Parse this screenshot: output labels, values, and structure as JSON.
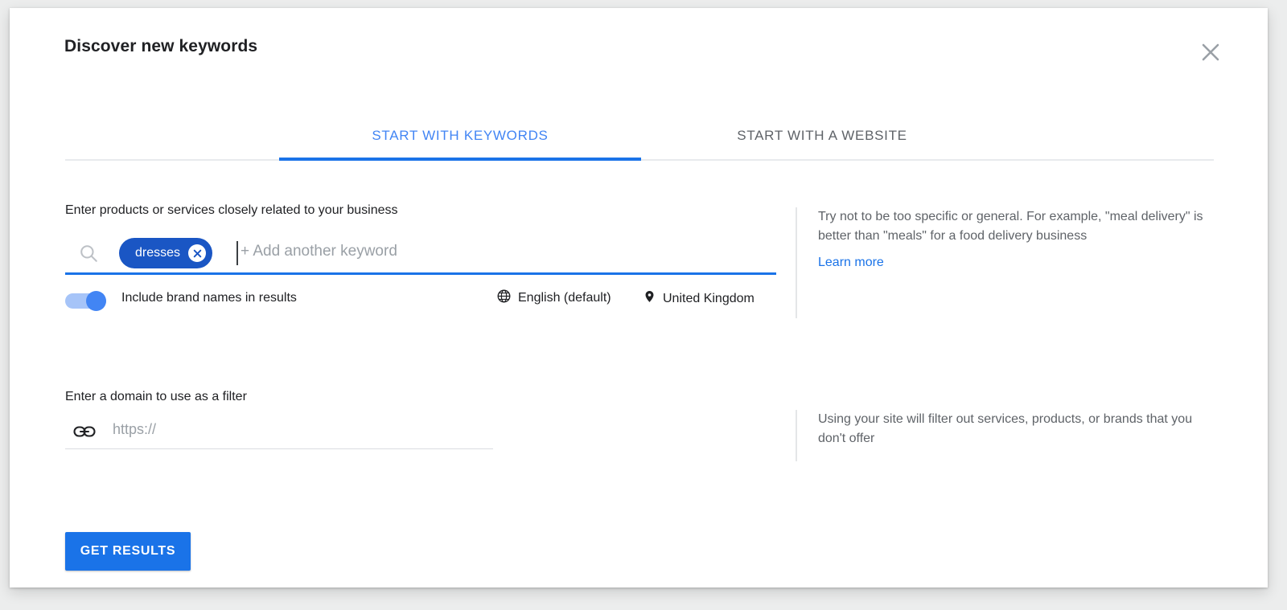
{
  "dialog": {
    "title": "Discover new keywords",
    "close_icon": "close-icon"
  },
  "tabs": [
    {
      "label": "START WITH KEYWORDS",
      "selected": true
    },
    {
      "label": "START WITH A WEBSITE",
      "selected": false
    }
  ],
  "keywords_section": {
    "label": "Enter products or services closely related to your business",
    "search_icon": "search-icon",
    "chips": [
      {
        "label": "dresses",
        "remove_icon": "close-circle-icon"
      }
    ],
    "input_placeholder": "+ Add another keyword",
    "input_value": "",
    "toggle": {
      "label": "Include brand names in results",
      "state": "on"
    },
    "language": {
      "icon": "globe-icon",
      "value": "English (default)"
    },
    "location": {
      "icon": "location-pin-icon",
      "value": "United Kingdom"
    }
  },
  "domain_section": {
    "label": "Enter a domain to use as a filter",
    "link_icon": "link-icon",
    "input_placeholder": "https://",
    "input_value": ""
  },
  "tips": {
    "keywords_tip": "Try not to be too specific or general. For example, \"meal delivery\" is better than \"meals\" for a food delivery business",
    "learn_more": "Learn more",
    "domain_tip": "Using your site will filter out services, products, or brands that you don't offer"
  },
  "footer": {
    "submit_label": "GET RESULTS"
  },
  "colors": {
    "accent": "#1a73e8",
    "tab_active": "#4285f4",
    "chip_bg": "#1a56c4",
    "text_primary": "#202124",
    "text_secondary": "#5f6368",
    "placeholder": "#9aa0a6"
  }
}
